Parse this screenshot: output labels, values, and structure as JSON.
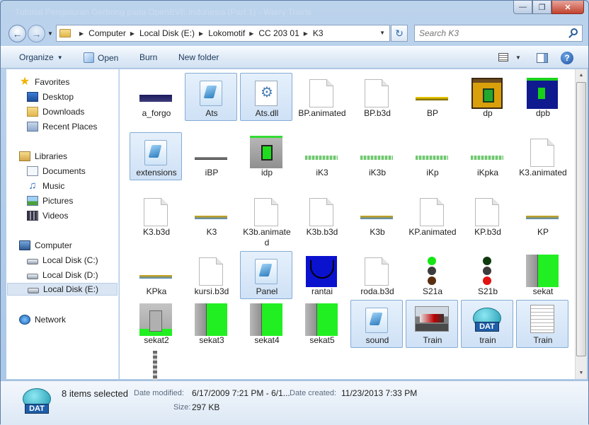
{
  "window": {
    "title": "Tutorial Pengaturan Gerbong pada OpenBVE Indonesia (Part 1) - Warry Trains"
  },
  "address": {
    "crumbs": [
      "Computer",
      "Local Disk (E:)",
      "Lokomotif",
      "CC 203 01",
      "K3"
    ]
  },
  "search": {
    "placeholder": "Search K3"
  },
  "toolbar": {
    "organize": "Organize",
    "open": "Open",
    "burn": "Burn",
    "new_folder": "New folder"
  },
  "nav": {
    "favorites": "Favorites",
    "desktop": "Desktop",
    "downloads": "Downloads",
    "recent": "Recent Places",
    "libraries": "Libraries",
    "documents": "Documents",
    "music": "Music",
    "pictures": "Pictures",
    "videos": "Videos",
    "computer": "Computer",
    "drive_c": "Local Disk (C:)",
    "drive_d": "Local Disk (D:)",
    "drive_e": "Local Disk (E:)",
    "network": "Network"
  },
  "files": [
    {
      "name": "a_forgo"
    },
    {
      "name": "Ats"
    },
    {
      "name": "Ats.dll"
    },
    {
      "name": "BP.animated"
    },
    {
      "name": "BP.b3d"
    },
    {
      "name": "BP"
    },
    {
      "name": "dp"
    },
    {
      "name": "dpb"
    },
    {
      "name": "extensions"
    },
    {
      "name": "iBP"
    },
    {
      "name": "idp"
    },
    {
      "name": "iK3"
    },
    {
      "name": "iK3b"
    },
    {
      "name": "iKp"
    },
    {
      "name": "iKpka"
    },
    {
      "name": "K3.animated"
    },
    {
      "name": "K3.b3d"
    },
    {
      "name": "K3"
    },
    {
      "name": "K3b.animated"
    },
    {
      "name": "K3b.b3d"
    },
    {
      "name": "K3b"
    },
    {
      "name": "KP.animated"
    },
    {
      "name": "KP.b3d"
    },
    {
      "name": "KP"
    },
    {
      "name": "KPka"
    },
    {
      "name": "kursi.b3d"
    },
    {
      "name": "Panel"
    },
    {
      "name": "rantai"
    },
    {
      "name": "roda.b3d"
    },
    {
      "name": "S21a"
    },
    {
      "name": "S21b"
    },
    {
      "name": "sekat"
    },
    {
      "name": "sekat2"
    },
    {
      "name": "sekat3"
    },
    {
      "name": "sekat4"
    },
    {
      "name": "sekat5"
    },
    {
      "name": "sound"
    },
    {
      "name": "Train"
    },
    {
      "name": "train"
    },
    {
      "name": "Train"
    }
  ],
  "details": {
    "selection": "8 items selected",
    "modified_label": "Date modified:",
    "modified_value": "6/17/2009 7:21 PM - 6/1...",
    "created_label": "Date created:",
    "created_value": "11/23/2013 7:33 PM",
    "size_label": "Size:",
    "size_value": "297 KB",
    "icon_text": "DAT"
  }
}
